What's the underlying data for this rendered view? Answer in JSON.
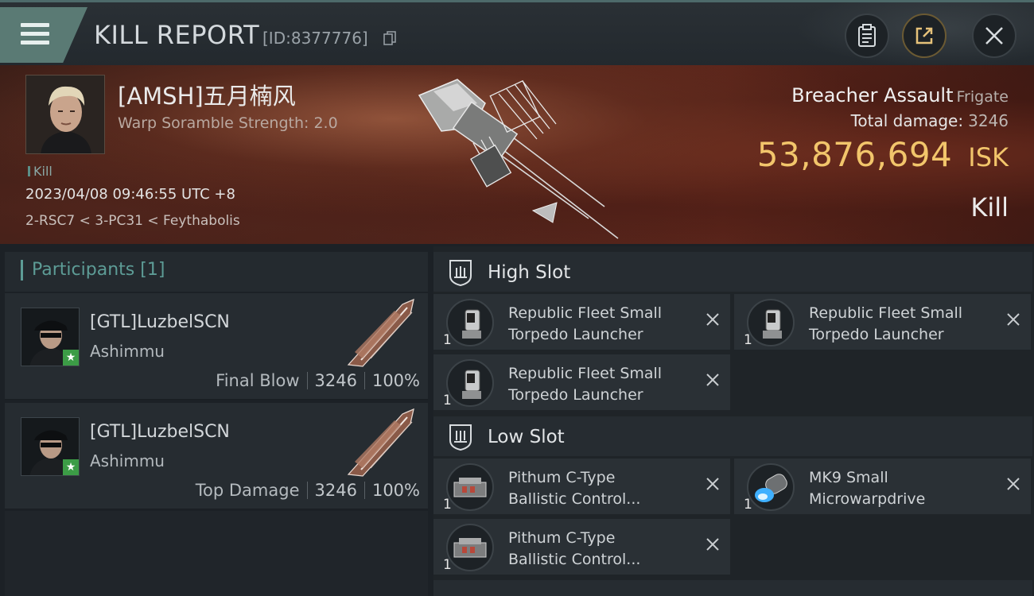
{
  "header": {
    "title": "KILL REPORT",
    "report_id": "[ID:8377776]"
  },
  "victim": {
    "pilot_name": "[AMSH]五月楠风",
    "scramble_text": "Warp Soramble Strength: 2.0",
    "kill_tag": "Kill",
    "datetime": "2023/04/08 09:46:55 UTC +8",
    "location": "2-RSC7 < 3-PC31 < Feythabolis",
    "ship_name": "Breacher Assault",
    "ship_class": "Frigate",
    "total_damage_label": "Total damage:",
    "total_damage_value": "3246",
    "isk_value": "53,876,694",
    "isk_unit": "ISK",
    "result": "Kill"
  },
  "participants": {
    "header_label": "Participants",
    "count": "[1]",
    "rows": [
      {
        "name": "[GTL]LuzbelSCN",
        "corp": "Ashimmu",
        "label": "Final Blow",
        "damage": "3246",
        "percent": "100%"
      },
      {
        "name": "[GTL]LuzbelSCN",
        "corp": "Ashimmu",
        "label": "Top Damage",
        "damage": "3246",
        "percent": "100%"
      }
    ]
  },
  "fitting": {
    "high_slot": {
      "label": "High Slot",
      "modules": [
        {
          "line1": "Republic Fleet Small",
          "line2": "Torpedo Launcher",
          "qty": "1",
          "icon": "torpedo-launcher-icon"
        },
        {
          "line1": "Republic Fleet Small",
          "line2": "Torpedo Launcher",
          "qty": "1",
          "icon": "torpedo-launcher-icon"
        },
        {
          "line1": "Republic Fleet Small",
          "line2": "Torpedo Launcher",
          "qty": "1",
          "icon": "torpedo-launcher-icon"
        }
      ]
    },
    "low_slot": {
      "label": "Low Slot",
      "modules": [
        {
          "line1": "Pithum C-Type",
          "line2": "Ballistic Control...",
          "qty": "1",
          "icon": "ballistic-control-icon"
        },
        {
          "line1": "MK9 Small",
          "line2": "Microwarpdrive",
          "qty": "1",
          "icon": "microwarpdrive-icon"
        },
        {
          "line1": "Pithum C-Type",
          "line2": "Ballistic Control...",
          "qty": "1",
          "icon": "ballistic-control-icon"
        }
      ]
    }
  },
  "colors": {
    "accent_teal": "#5d9c96",
    "isk_gold": "#f2c56b",
    "banner_red": "#4a2119",
    "panel": "#262c31"
  }
}
